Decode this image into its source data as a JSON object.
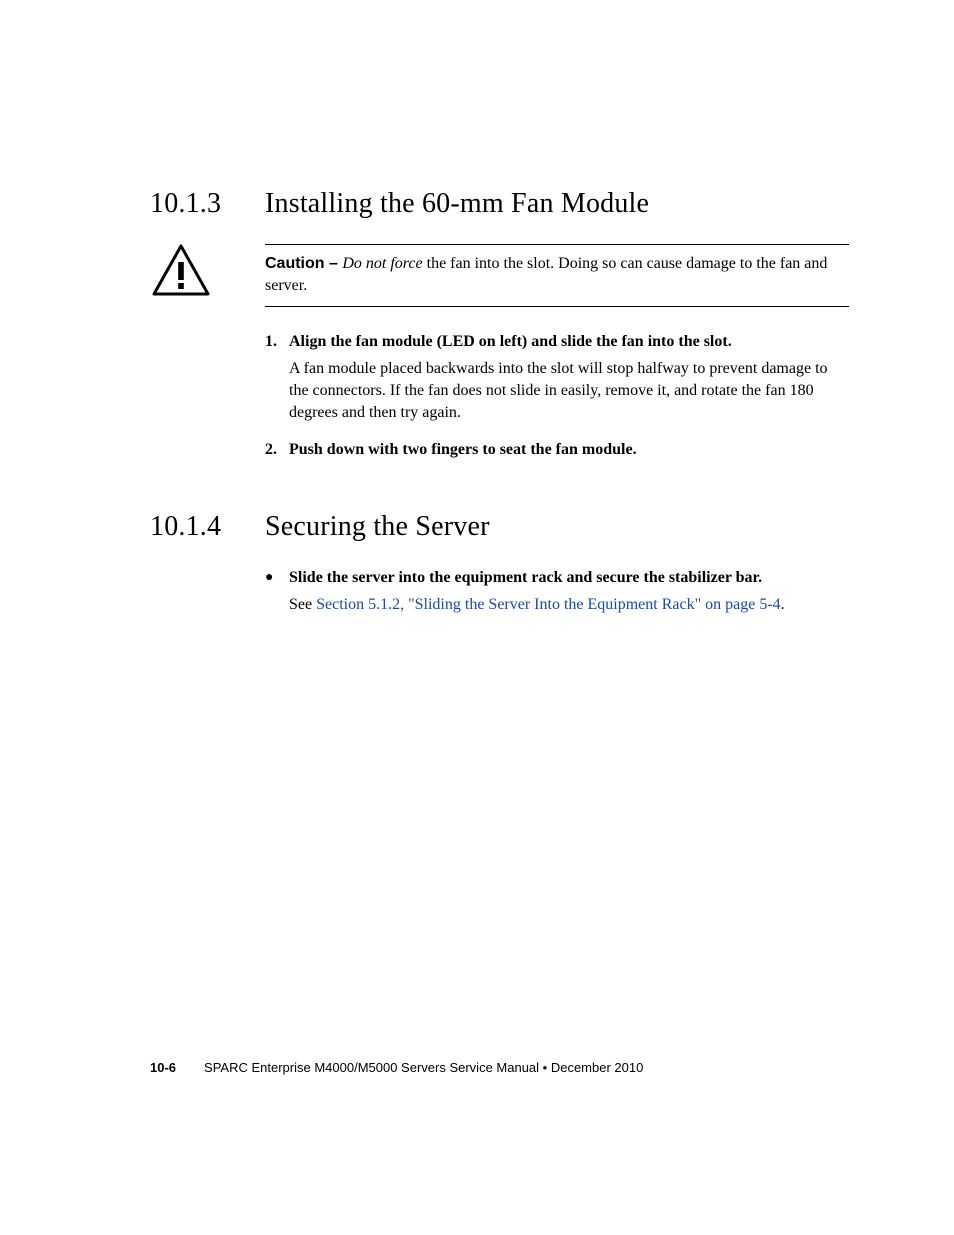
{
  "section1": {
    "number": "10.1.3",
    "title": "Installing the 60-mm Fan Module",
    "caution": {
      "label": "Caution – ",
      "italic": "Do not force",
      "rest": " the fan into the slot. Doing so can cause damage to the fan and server."
    },
    "steps": [
      {
        "num": "1.",
        "title": "Align the fan module (LED on left) and slide the fan into the slot.",
        "body": "A fan module placed backwards into the slot will stop halfway to prevent damage to the connectors. If the fan does not slide in easily, remove it, and rotate the fan 180 degrees and then try again."
      },
      {
        "num": "2.",
        "title": "Push down with two fingers to seat the fan module.",
        "body": ""
      }
    ]
  },
  "section2": {
    "number": "10.1.4",
    "title": "Securing the Server",
    "bullet": {
      "symbol": "●",
      "text": "Slide the server into the equipment rack and secure the stabilizer bar.",
      "sub_prefix": "See ",
      "sub_link": "Section 5.1.2, \"Sliding the Server Into the Equipment Rack\" on page 5-4",
      "sub_suffix": "."
    }
  },
  "footer": {
    "page_num": "10-6",
    "title": "SPARC Enterprise M4000/M5000 Servers Service Manual  •  December 2010"
  }
}
